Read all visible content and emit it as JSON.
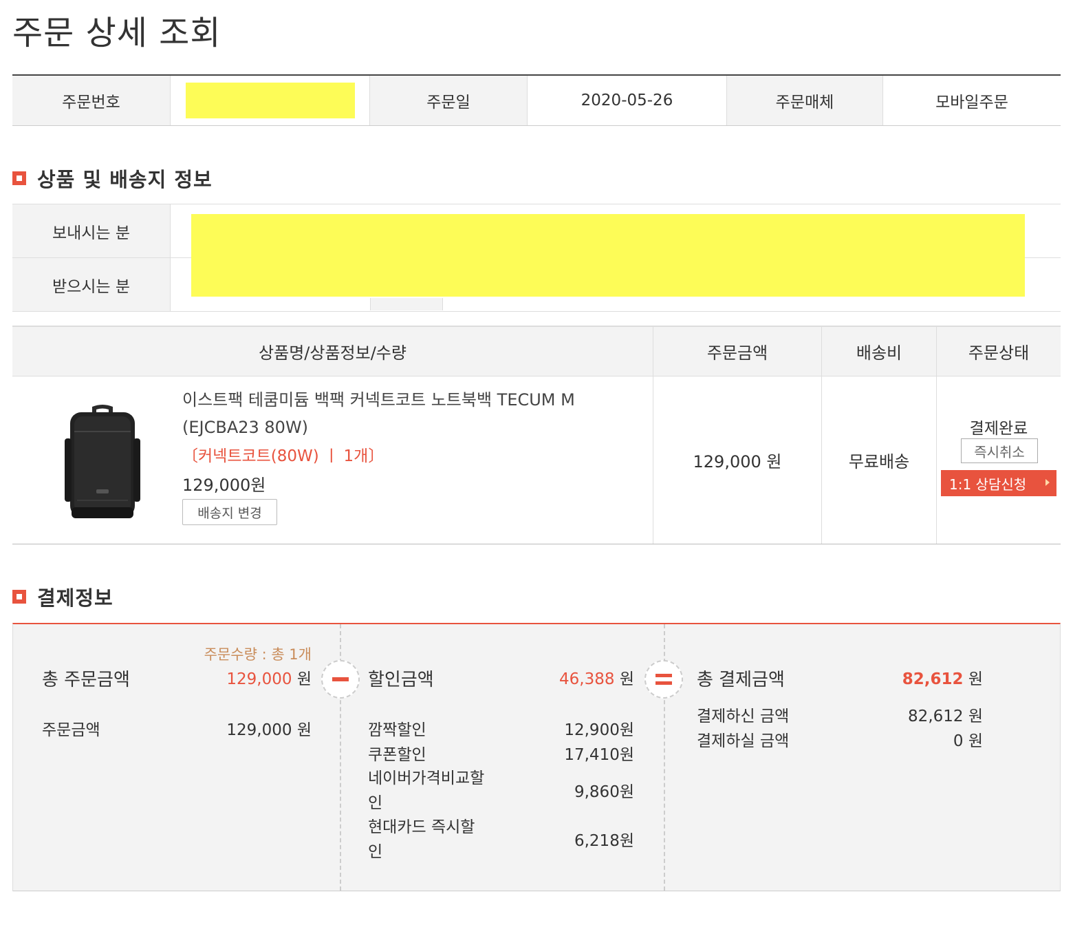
{
  "page": {
    "title": "주문 상세 조회"
  },
  "order_info": {
    "order_number_label": "주문번호",
    "order_date_label": "주문일",
    "order_date": "2020-05-26",
    "order_channel_label": "주문매체",
    "order_channel": "모바일주문"
  },
  "shipping_section": {
    "title": "상품 및 배송지 정보",
    "sender_label": "보내시는 분",
    "receiver_label": "받으시는 분"
  },
  "product_table": {
    "headers": [
      "상품명/상품정보/수량",
      "주문금액",
      "배송비",
      "주문상태"
    ],
    "item": {
      "name": "이스트팩 테쿰미듐 백팩 커넥트코트 노트북백 TECUM M (EJCBA23 80W)",
      "option": "〔커넥트코트(80W)  ㅣ  1개〕",
      "price": "129,000원",
      "change_address_button": "배송지 변경",
      "order_amount": "129,000 원",
      "shipping_fee": "무료배송",
      "status": "결제완료",
      "cancel_button": "즉시취소",
      "consult_button": "1:1 상담신청"
    }
  },
  "payment_section": {
    "title": "결제정보",
    "order_qty_note": "주문수량 : 총 1개",
    "total_order_label": "총 주문금액",
    "total_order_value": "129,000",
    "won": "원",
    "order_amount_label": "주문금액",
    "order_amount_value": "129,000 원",
    "discount_label": "할인금액",
    "discount_value": "46,388",
    "discounts": [
      {
        "label": "깜짝할인",
        "value": "12,900원"
      },
      {
        "label": "쿠폰할인",
        "value": "17,410원"
      },
      {
        "label": "네이버가격비교할\n인",
        "value": "9,860원"
      },
      {
        "label": "현대카드 즉시할\n인",
        "value": "6,218원"
      }
    ],
    "total_pay_label": "총 결제금액",
    "total_pay_value": "82,612",
    "paid_label": "결제하신 금액",
    "paid_value": "82,612 원",
    "to_pay_label": "결제하실 금액",
    "to_pay_value": "0 원"
  },
  "colors": {
    "accent": "#e8533e",
    "redaction": "#fdfc57",
    "header_bg": "#f3f3f3"
  }
}
